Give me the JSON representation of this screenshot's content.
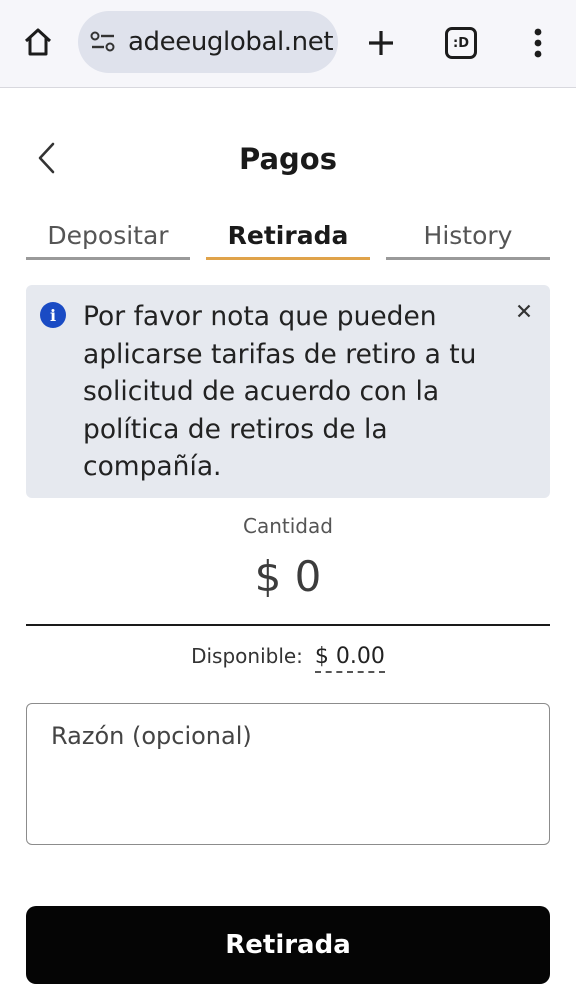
{
  "browser": {
    "url": "adeeuglobal.net",
    "tabs_count_label": ":D",
    "icons": [
      "home-icon",
      "site-settings-icon",
      "plus-icon",
      "tabs-icon",
      "more-vert-icon"
    ]
  },
  "header": {
    "title": "Pagos",
    "back_icon": "chevron-left-icon"
  },
  "tabs": [
    {
      "label": "Depositar",
      "active": false
    },
    {
      "label": "Retirada",
      "active": true
    },
    {
      "label": "History",
      "active": false
    }
  ],
  "notice": {
    "text": "Por favor nota que pueden aplicarse tarifas de retiro a tu solicitud de acuerdo con la política de retiros de la compañía.",
    "icon": "info-icon",
    "icon_glyph": "i",
    "close_icon": "close-icon"
  },
  "amount": {
    "label": "Cantidad",
    "value": "$ 0"
  },
  "available": {
    "label": "Disponible:",
    "value": "$ 0.00"
  },
  "reason": {
    "placeholder": "Razón (opcional)"
  },
  "submit": {
    "label": "Retirada"
  },
  "colors": {
    "accent_tab_underline": "#e0a34a",
    "info_icon": "#1a4bc4",
    "notice_bg": "#e6e9ef",
    "button_bg": "#050505"
  }
}
